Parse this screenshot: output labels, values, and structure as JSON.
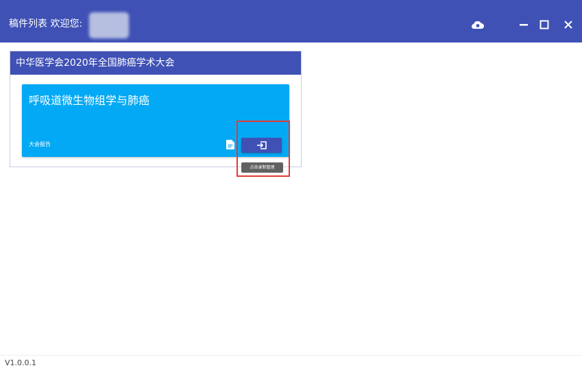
{
  "window": {
    "title": "稿件列表 欢迎您:",
    "controls": {
      "cloud_icon": "cloud-icon",
      "minimize_icon": "minimize-icon",
      "maximize_icon": "maximize-icon",
      "close_icon": "close-icon"
    }
  },
  "conference": {
    "title": "中华医学会2020年全国肺癌学术大会",
    "papers": [
      {
        "title": "呼吸道微生物组学与肺癌",
        "type": "大会报告",
        "file_icon": "file-icon",
        "action_icon": "sign-in-icon",
        "tooltip": "点击录制管理"
      }
    ]
  },
  "footer": {
    "version": "V1.0.0.1"
  },
  "colors": {
    "primary": "#3f51b5",
    "card": "#03a9f4",
    "highlight": "#e53935",
    "tooltip": "#616161"
  }
}
